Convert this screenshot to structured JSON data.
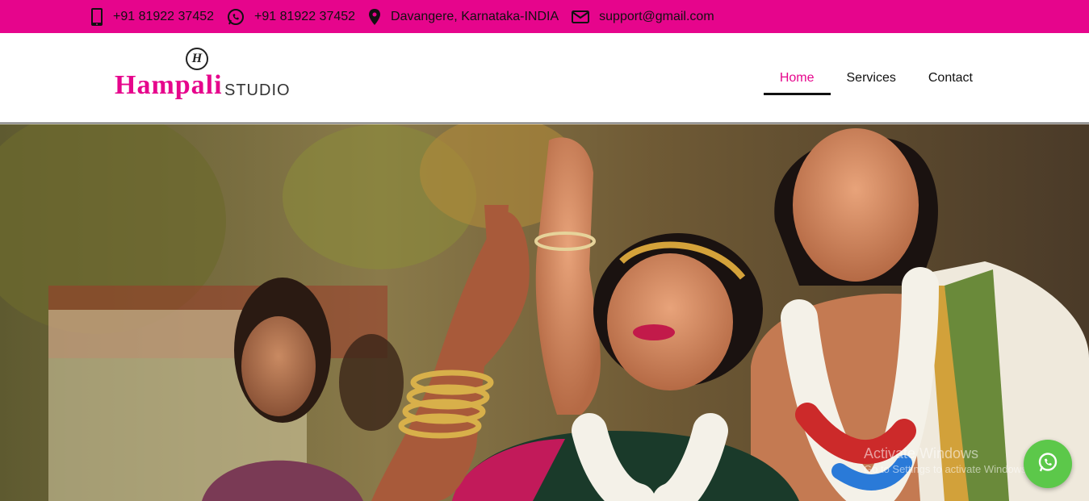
{
  "topbar": {
    "phone": "+91 81922 37452",
    "whatsapp": "+91 81922 37452",
    "location": "Davangere, Karnataka-INDIA",
    "email": "support@gmail.com"
  },
  "logo": {
    "emblem": "H",
    "main": "Hampali",
    "sub": "STUDIO"
  },
  "nav": {
    "items": [
      {
        "label": "Home",
        "active": true
      },
      {
        "label": "Services",
        "active": false
      },
      {
        "label": "Contact",
        "active": false
      }
    ]
  },
  "hero": {
    "image": "wedding couple photo"
  },
  "watermark": {
    "title": "Activate Windows",
    "subtitle": "Go to Settings to activate Windows."
  },
  "icons": {
    "phone": "phone-icon",
    "whatsapp": "whatsapp-icon",
    "location": "map-marker-icon",
    "email": "envelope-icon",
    "floating": "whatsapp-chat-icon"
  },
  "colors": {
    "brand": "#e6058c",
    "whatsapp": "#5cc84a"
  }
}
